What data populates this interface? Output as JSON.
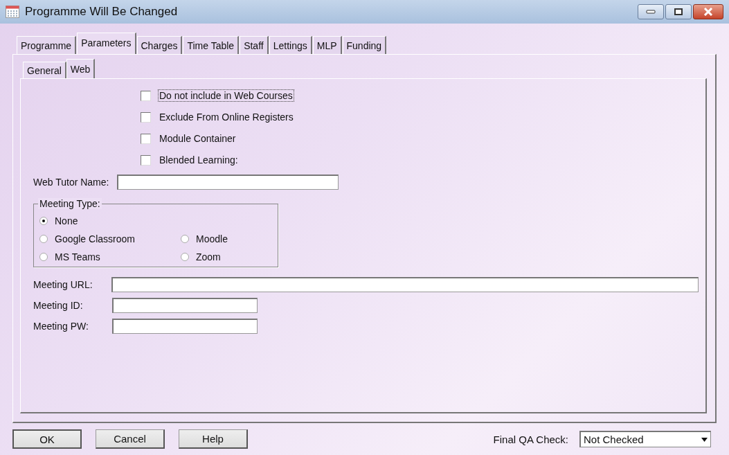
{
  "window": {
    "title": "Programme Will Be Changed"
  },
  "tabs": [
    {
      "label": "Programme",
      "selected": false
    },
    {
      "label": "Parameters",
      "selected": true
    },
    {
      "label": "Charges",
      "selected": false
    },
    {
      "label": "Time Table",
      "selected": false
    },
    {
      "label": "Staff",
      "selected": false
    },
    {
      "label": "Lettings",
      "selected": false
    },
    {
      "label": "MLP",
      "selected": false
    },
    {
      "label": "Funding",
      "selected": false
    }
  ],
  "subtabs": [
    {
      "label": "General",
      "selected": false
    },
    {
      "label": "Web",
      "selected": true
    }
  ],
  "checkboxes": [
    {
      "label": "Do not include in Web Courses",
      "checked": false,
      "focused": true
    },
    {
      "label": "Exclude From Online Registers",
      "checked": false,
      "focused": false
    },
    {
      "label": "Module Container",
      "checked": false,
      "focused": false
    },
    {
      "label": "Blended Learning:",
      "checked": false,
      "focused": false
    }
  ],
  "web_tutor_name": {
    "label": "Web Tutor Name:"
  },
  "meeting_type": {
    "title": "Meeting Type:",
    "options": [
      {
        "label": "None",
        "selected": true
      },
      {
        "label": "Google Classroom",
        "selected": false
      },
      {
        "label": "Moodle",
        "selected": false
      },
      {
        "label": "MS Teams",
        "selected": false
      },
      {
        "label": "Zoom",
        "selected": false
      }
    ]
  },
  "meeting_fields": [
    {
      "label": "Meeting URL:"
    },
    {
      "label": "Meeting ID:"
    },
    {
      "label": "Meeting PW:"
    }
  ],
  "buttons": [
    "OK",
    "Cancel",
    "Help"
  ],
  "final_qa": {
    "label": "Final QA Check:",
    "value": "Not Checked"
  }
}
